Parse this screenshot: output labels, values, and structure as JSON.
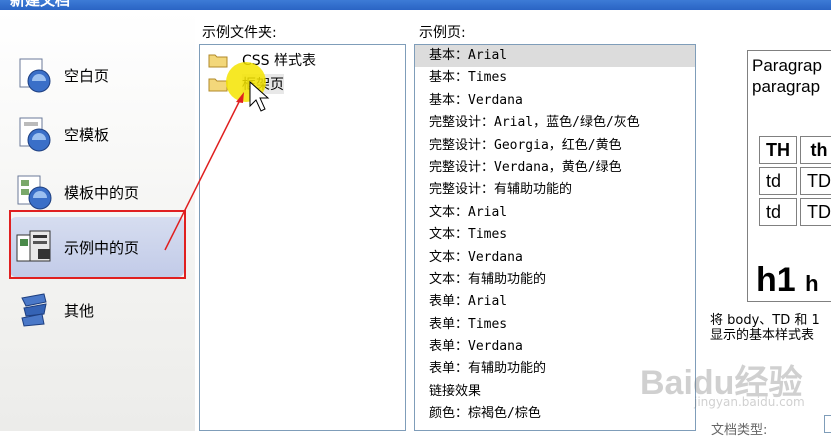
{
  "window": {
    "title": "新建文档"
  },
  "categories": [
    {
      "label": "空白页",
      "icon": "blank-page-icon",
      "selected": false
    },
    {
      "label": "空模板",
      "icon": "blank-template-icon",
      "selected": false
    },
    {
      "label": "模板中的页",
      "icon": "template-page-icon",
      "selected": false
    },
    {
      "label": "示例中的页",
      "icon": "sample-page-icon",
      "selected": true
    },
    {
      "label": "其他",
      "icon": "other-icon",
      "selected": false
    }
  ],
  "folders_header": "示例文件夹:",
  "folders": [
    {
      "label": "CSS 样式表",
      "selected": false
    },
    {
      "label": "框架页",
      "selected": true
    }
  ],
  "pages_header": "示例页:",
  "pages": [
    "基本：Arial",
    "基本：Times",
    "基本：Verdana",
    "完整设计：Arial，蓝色/绿色/灰色",
    "完整设计：Georgia，红色/黄色",
    "完整设计：Verdana，黄色/绿色",
    "完整设计：有辅助功能的",
    "文本：Arial",
    "文本：Times",
    "文本：Verdana",
    "文本：有辅助功能的",
    "表单：Arial",
    "表单：Times",
    "表单：Verdana",
    "表单：有辅助功能的",
    "链接效果",
    "颜色：棕褐色/棕色"
  ],
  "selected_page_index": 0,
  "preview": {
    "paragraph_line1": "Paragrap",
    "paragraph_line2": "paragrap",
    "table_header": [
      "TH",
      "th"
    ],
    "table_rows": [
      [
        "td",
        "TD"
      ],
      [
        "td",
        "TD"
      ]
    ],
    "heading_big": "h1",
    "heading_small": "h"
  },
  "description_line1": "将 body、TD 和 1",
  "description_line2": "显示的基本样式表",
  "doc_type_label": "文档类型:",
  "watermark": {
    "brand": "Baidu经验",
    "url": "jingyan.baidu.com"
  },
  "colors": {
    "selection_red": "#e02020",
    "titlebar_blue": "#2a64c4",
    "list_border": "#7f9db9"
  }
}
